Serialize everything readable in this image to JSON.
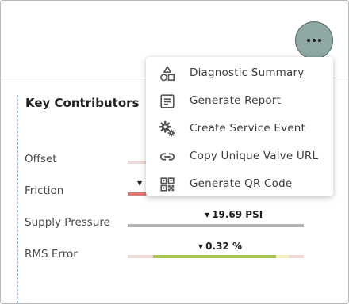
{
  "panel": {
    "title": "Key Contributors",
    "metrics": [
      {
        "label": "Offset",
        "value": ""
      },
      {
        "label": "Friction",
        "value": ""
      },
      {
        "label": "Supply Pressure",
        "value": "19.69 PSI"
      },
      {
        "label": "RMS Error",
        "value": "0.32 %"
      }
    ]
  },
  "more_button": {
    "icon": "more-horizontal-icon"
  },
  "menu": {
    "items": [
      {
        "label": "Diagnostic Summary",
        "icon": "shapes-icon"
      },
      {
        "label": "Generate Report",
        "icon": "document-icon"
      },
      {
        "label": "Create Service Event",
        "icon": "gears-icon"
      },
      {
        "label": "Copy Unique Valve URL",
        "icon": "link-icon"
      },
      {
        "label": "Generate QR Code",
        "icon": "qr-code-icon"
      }
    ]
  },
  "colors": {
    "accent_button": "#8fa8a4",
    "bar_track": "#eed9d6",
    "bar_red": "#d9796f",
    "bar_gray": "#b3b3b3",
    "bar_green": "#a8c454",
    "bar_yellow": "#f3f1bf"
  }
}
